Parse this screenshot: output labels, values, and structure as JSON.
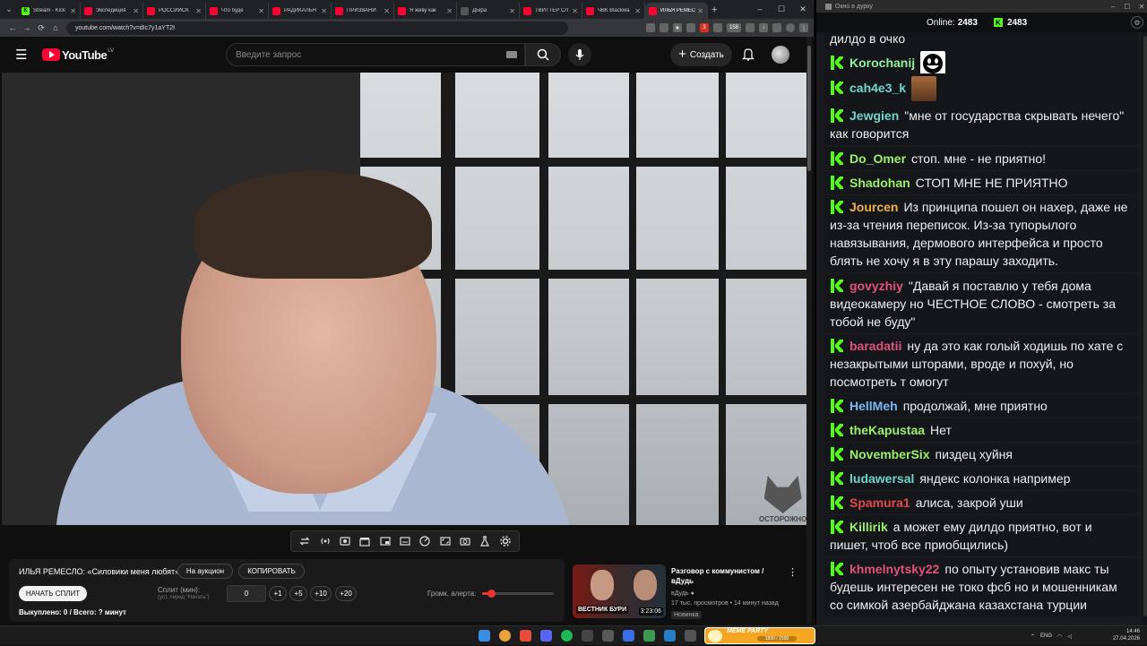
{
  "browser": {
    "tabs": [
      {
        "icon": "kick",
        "title": "Stream - Kick",
        "active": false
      },
      {
        "icon": "youtube",
        "title": "Экспедиция",
        "active": false
      },
      {
        "icon": "youtube",
        "title": "РОССИЙСК",
        "active": false
      },
      {
        "icon": "youtube",
        "title": "Что буде",
        "active": false
      },
      {
        "icon": "youtube",
        "title": "РАДИКАЛЬН",
        "active": false
      },
      {
        "icon": "youtube",
        "title": "ПРИЗВАНИ",
        "active": false
      },
      {
        "icon": "youtube",
        "title": "Я живу как",
        "active": false
      },
      {
        "icon": "dw",
        "title": "ДЫра",
        "active": false
      },
      {
        "icon": "youtube",
        "title": "ТВИТТЕР СЛ",
        "active": false
      },
      {
        "icon": "youtube",
        "title": "ЧВК Blackwa",
        "active": false
      },
      {
        "icon": "youtube",
        "title": "ИЛЬЯ РЕМЕС",
        "active": true
      }
    ],
    "new_tab": "+",
    "url": "youtube.com/watch?v=dIc7y1aYT2I",
    "ext_badge_1": "3",
    "ext_badge_2": "158"
  },
  "youtube": {
    "logo_text": "YouTube",
    "country_code": "LV",
    "search_placeholder": "Введите запрос",
    "create_label": "Создать"
  },
  "video": {
    "watermark": "ОСТОРОЖНО"
  },
  "toolbar_icons": [
    "loop-icon",
    "broadcast-icon",
    "camera-settings-icon",
    "clapper-icon",
    "pip-icon",
    "subtitles-icon",
    "speed-icon",
    "aspect-icon",
    "screenshot-icon",
    "flask-icon",
    "settings-icon"
  ],
  "panel": {
    "title": "ИЛЬЯ РЕМЕСЛО: «Силовики меня любят»",
    "auction_btn": "На аукцион",
    "copy_btn": "КОПИРОВАТЬ",
    "start_split_btn": "НАЧАТЬ СПЛИТ",
    "split_label": "Сплит (мин):",
    "split_hint": "(уст. перед \"Начать\")",
    "split_value": "0",
    "increments": [
      "+1",
      "+5",
      "+10",
      "+20"
    ],
    "volume_label": "Громк. алерта:",
    "volume_level": 0.12,
    "bought_text": "Выкуплено: 0 / Всего: ? минут"
  },
  "recommended": {
    "title": "Разговор с коммунистом / вДудь",
    "channel": "вДудь",
    "meta": "17 тыс. просмотров • 14 минут назад",
    "badge": "Новинка",
    "thumb_label": "ВЕСТНИК БУРИ",
    "duration": "3:23:06"
  },
  "chat": {
    "window_title": "Окно в дурку",
    "online_label": "Online:",
    "online_count": "2483",
    "kick_count": "2483",
    "accent": "#53fc18",
    "messages": [
      {
        "user": "",
        "color": "#efeff1",
        "text": "дилдо в очко",
        "emote": ""
      },
      {
        "user": "Korochanij",
        "color": "#8ff0a4",
        "text": "",
        "emote": "smile"
      },
      {
        "user": "cah4e3_k",
        "color": "#6fd6c8",
        "text": "",
        "emote": "face"
      },
      {
        "user": "Jewgien",
        "color": "#6fd6c8",
        "text": "\"мне от государства скрывать нечего\" как говорится",
        "emote": ""
      },
      {
        "user": "Do_Omer",
        "color": "#9cf06a",
        "text": "стоп. мне - не приятно!",
        "emote": ""
      },
      {
        "user": "Shadohan",
        "color": "#9cf06a",
        "text": "СТОП МНЕ НЕ ПРИЯТНО",
        "emote": ""
      },
      {
        "user": "Jourcen",
        "color": "#f0b04a",
        "text": "Из принципа пошел он нахер, даже не из-за чтения переписок. Из-за тупорылого навязывания, дермового интерфейса и просто блять не хочу я в эту парашу заходить.",
        "emote": ""
      },
      {
        "user": "govyzhiy",
        "color": "#e0537a",
        "text": "\"Давай я поставлю у тебя дома видеокамеру но ЧЕСТНОЕ СЛОВО - смотреть за тобой не буду\"",
        "emote": ""
      },
      {
        "user": "baradatii",
        "color": "#e0537a",
        "text": "ну да это как голый ходишь по хате с незакрытыми шторами, вроде и похуй, но посмотреть т омогут",
        "emote": ""
      },
      {
        "user": "HellMeh",
        "color": "#7ab8f5",
        "text": "продолжай, мне приятно",
        "emote": ""
      },
      {
        "user": "theKapustaa",
        "color": "#9cf06a",
        "text": "Нет",
        "emote": ""
      },
      {
        "user": "NovemberSix",
        "color": "#9cf06a",
        "text": "пиздец хуйня",
        "emote": ""
      },
      {
        "user": "ludawersal",
        "color": "#6fd6c8",
        "text": "яндекс колонка например",
        "emote": ""
      },
      {
        "user": "Spamura1",
        "color": "#e04a4a",
        "text": "алиса, закрой уши",
        "emote": ""
      },
      {
        "user": "Killirik",
        "color": "#9cf06a",
        "text": "а может ему дилдо приятно, вот и пишет, чтоб все приобщились)",
        "emote": ""
      },
      {
        "user": "khmelnytsky22",
        "color": "#e0537a",
        "text": "по опыту установив макс ты будешь интересен не токо фсб но и мошенникам со симкой азербайджана казахстана турции",
        "emote": ""
      }
    ]
  },
  "taskbar": {
    "meme_title": "MEME PARTY",
    "meme_progress": "1800 / 1500",
    "lang": "ENG",
    "time": "14:46",
    "date": "27.04.2026"
  }
}
